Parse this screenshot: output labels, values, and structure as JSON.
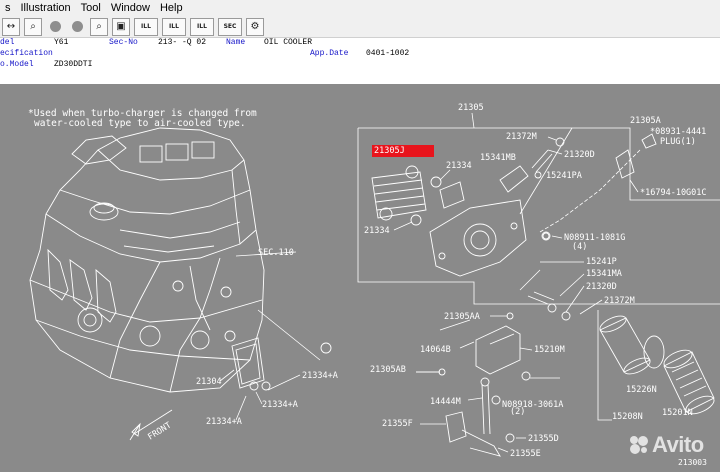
{
  "menu": [
    "s",
    "Illustration",
    "Tool",
    "Window",
    "Help"
  ],
  "toolbar": {
    "buttons": [
      {
        "name": "arrows-icon",
        "glyph": "↔"
      },
      {
        "name": "search-icon",
        "glyph": "⌕"
      },
      {
        "name": "circle-icon",
        "glyph": ""
      },
      {
        "name": "circle-icon-2",
        "glyph": ""
      },
      {
        "name": "zoom-icon",
        "glyph": "⌕"
      },
      {
        "name": "zoom-out-icon",
        "glyph": "▣"
      },
      {
        "name": "ill-list-icon",
        "glyph": "ILL"
      },
      {
        "name": "ill-icon",
        "glyph": "ILL"
      },
      {
        "name": "ill-2-icon",
        "glyph": "ILL"
      },
      {
        "name": "sec-icon",
        "glyph": "SEC"
      },
      {
        "name": "gear-icon",
        "glyph": "⚙"
      }
    ]
  },
  "info": {
    "model_label": "del",
    "model_value": "Y61",
    "secno_label": "Sec-No",
    "secno_value": "213-  -Q 02",
    "name_label": "Name",
    "name_value": "OIL COOLER",
    "spec_label": "ecification",
    "appdate_label": "App.Date",
    "appdate_value": "0401-1002",
    "pmodel_label": "o.Model",
    "pmodel_value": "ZD30DDTI"
  },
  "diagram": {
    "note_line1": "*Used when turbo-charger is changed from",
    "note_line2": "water-cooled type to air-cooled type.",
    "highlight": "21305J",
    "sec_ref": "SEC.110",
    "front": "FRONT",
    "labels": {
      "p21305": "21305",
      "p21305A": "21305A",
      "p08931": "*08931-4441",
      "plug": "PLUG(1)",
      "p16794": "*16794-10G01C",
      "p21372M_top": "21372M",
      "p21320D_top": "21320D",
      "p15341MB": "15341MB",
      "p15241PA": "15241PA",
      "p21334_top": "21334",
      "p21334_left": "21334",
      "p08911": "N08911-1081G",
      "p08911_qty": "(4)",
      "p15241P": "15241P",
      "p15341MA": "15341MA",
      "p21320D": "21320D",
      "p21372M": "21372M",
      "p21305AA": "21305AA",
      "p14064B": "14064B",
      "p15210M": "15210M",
      "p21305AB": "21305AB",
      "p14444M": "14444M",
      "p08918": "N08918-3061A",
      "p08918_qty": "(2)",
      "p15226N": "15226N",
      "p15208N": "15208N",
      "p15201N": "15201N",
      "p21355F": "21355F",
      "p21355D": "21355D",
      "p21355E": "21355E",
      "p21304": "21304",
      "p21334A": "21334+A",
      "p21334A_2": "21334+A",
      "p21334A_3": "21334+A"
    }
  },
  "watermark": "Avito",
  "corner_code": "213003"
}
